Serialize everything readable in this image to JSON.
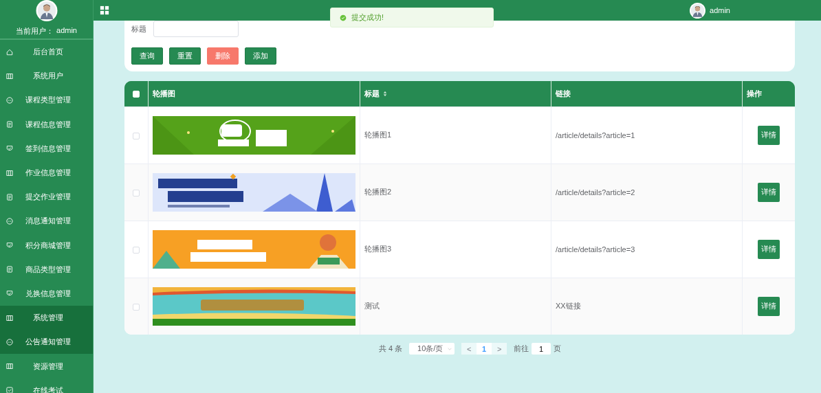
{
  "sidebar": {
    "user_label": "当前用户：",
    "user_name": "admin",
    "items": [
      {
        "label": "后台首页",
        "kind": "home",
        "selected": false
      },
      {
        "label": "系统用户",
        "kind": "columns",
        "selected": false
      },
      {
        "label": "课程类型管理",
        "kind": "chat",
        "selected": false
      },
      {
        "label": "课程信息管理",
        "kind": "doc",
        "selected": false
      },
      {
        "label": "签到信息管理",
        "kind": "shield",
        "selected": false
      },
      {
        "label": "作业信息管理",
        "kind": "columns",
        "selected": false
      },
      {
        "label": "提交作业管理",
        "kind": "doc",
        "selected": false
      },
      {
        "label": "消息通知管理",
        "kind": "chat",
        "selected": false
      },
      {
        "label": "积分商城管理",
        "kind": "shield",
        "selected": false
      },
      {
        "label": "商品类型管理",
        "kind": "doc",
        "selected": false
      },
      {
        "label": "兑换信息管理",
        "kind": "shield",
        "selected": false
      },
      {
        "label": "系统管理",
        "kind": "columns",
        "selected": true
      },
      {
        "label": "公告通知管理",
        "kind": "chat",
        "selected": true
      },
      {
        "label": "资源管理",
        "kind": "columns",
        "selected": false
      },
      {
        "label": "在线考试",
        "kind": "check",
        "selected": false
      }
    ]
  },
  "header": {
    "user_name": "admin"
  },
  "toast": {
    "message": "提交成功!"
  },
  "search": {
    "label": "标题",
    "buttons": [
      {
        "label": "查询",
        "kind": "normal"
      },
      {
        "label": "重置",
        "kind": "normal"
      },
      {
        "label": "删除",
        "kind": "danger"
      },
      {
        "label": "添加",
        "kind": "normal"
      }
    ]
  },
  "table": {
    "select_all": {
      "checked": false
    },
    "columns": [
      {
        "label": "轮播图",
        "sortable": false
      },
      {
        "label": "标题",
        "sortable": true
      },
      {
        "label": "链接",
        "sortable": false
      },
      {
        "label": "操作",
        "sortable": false
      }
    ],
    "rows": [
      {
        "checked": false,
        "title": "轮播图1",
        "link": "/article/details?article=1",
        "action": "详情"
      },
      {
        "checked": false,
        "title": "轮播图2",
        "link": "/article/details?article=2",
        "action": "详情"
      },
      {
        "checked": false,
        "title": "轮播图3",
        "link": "/article/details?article=3",
        "action": "详情"
      },
      {
        "checked": false,
        "title": "测试",
        "link": "XX链接",
        "action": "详情"
      }
    ]
  },
  "pagination": {
    "total": "共 4 条",
    "page_size": "10条/页",
    "prev": "<",
    "pages": [
      {
        "label": "1",
        "selected": true
      }
    ],
    "next": ">",
    "goto_label": "前往",
    "goto_value": "1",
    "goto_suffix": "页"
  }
}
